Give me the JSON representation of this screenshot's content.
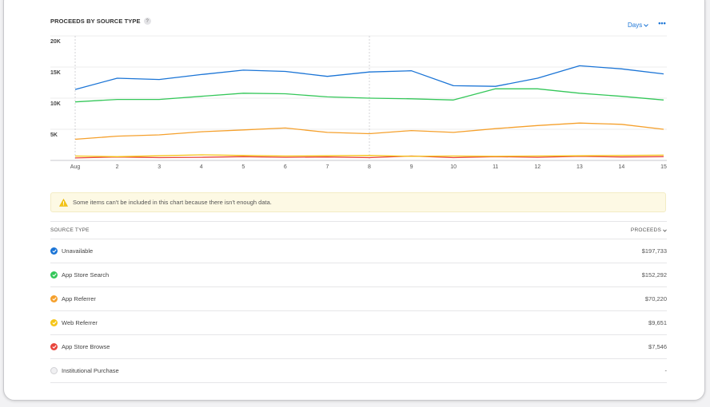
{
  "header": {
    "title": "PROCEEDS BY SOURCE TYPE",
    "help_label": "?",
    "days_label": "Days",
    "more_label": "•••"
  },
  "notice": {
    "text": "Some items can't be included in this chart because there isn't enough data."
  },
  "table": {
    "col_source": "SOURCE TYPE",
    "col_proceeds": "PROCEEDS",
    "rows": [
      {
        "label": "Unavailable",
        "value": "$197,733",
        "color": "#1a74d6",
        "checked": true
      },
      {
        "label": "App Store Search",
        "value": "$152,292",
        "color": "#34c759",
        "checked": true
      },
      {
        "label": "App Referrer",
        "value": "$70,220",
        "color": "#f5a02c",
        "checked": true
      },
      {
        "label": "Web Referrer",
        "value": "$9,651",
        "color": "#f5c518",
        "checked": true
      },
      {
        "label": "App Store Browse",
        "value": "$7,546",
        "color": "#e8453c",
        "checked": true
      },
      {
        "label": "Institutional Purchase",
        "value": "-",
        "color": "#d0d0d4",
        "checked": false
      }
    ]
  },
  "chart_data": {
    "type": "line",
    "title": "PROCEEDS BY SOURCE TYPE",
    "x": [
      "Aug",
      "2",
      "3",
      "4",
      "5",
      "6",
      "7",
      "8",
      "9",
      "10",
      "11",
      "12",
      "13",
      "14",
      "15"
    ],
    "ylim": [
      0,
      20000
    ],
    "yticks": [
      {
        "value": 20000,
        "label": "20K"
      },
      {
        "value": 15000,
        "label": "15K"
      },
      {
        "value": 10000,
        "label": "10K"
      },
      {
        "value": 5000,
        "label": "5K"
      }
    ],
    "grid": true,
    "series": [
      {
        "name": "Unavailable",
        "color": "#1a74d6",
        "values": [
          11400,
          13200,
          13000,
          13800,
          14500,
          14300,
          13500,
          14200,
          14400,
          12000,
          11900,
          13200,
          15200,
          14700,
          13900
        ]
      },
      {
        "name": "App Store Search",
        "color": "#34c759",
        "values": [
          9400,
          9800,
          9800,
          10300,
          10800,
          10700,
          10200,
          10000,
          9900,
          9700,
          11500,
          11500,
          10800,
          10300,
          9700
        ]
      },
      {
        "name": "App Referrer",
        "color": "#f5a02c",
        "values": [
          3400,
          3900,
          4100,
          4600,
          4900,
          5200,
          4500,
          4300,
          4800,
          4500,
          5100,
          5600,
          6000,
          5800,
          5000
        ]
      },
      {
        "name": "Web Referrer",
        "color": "#f5c518",
        "values": [
          700,
          600,
          750,
          900,
          800,
          700,
          750,
          800,
          650,
          700,
          650,
          700,
          750,
          800,
          850
        ]
      },
      {
        "name": "App Store Browse",
        "color": "#e8453c",
        "values": [
          400,
          550,
          450,
          500,
          600,
          500,
          550,
          450,
          700,
          450,
          600,
          500,
          650,
          550,
          600
        ]
      }
    ],
    "markers": [
      "Aug",
      "8"
    ]
  }
}
